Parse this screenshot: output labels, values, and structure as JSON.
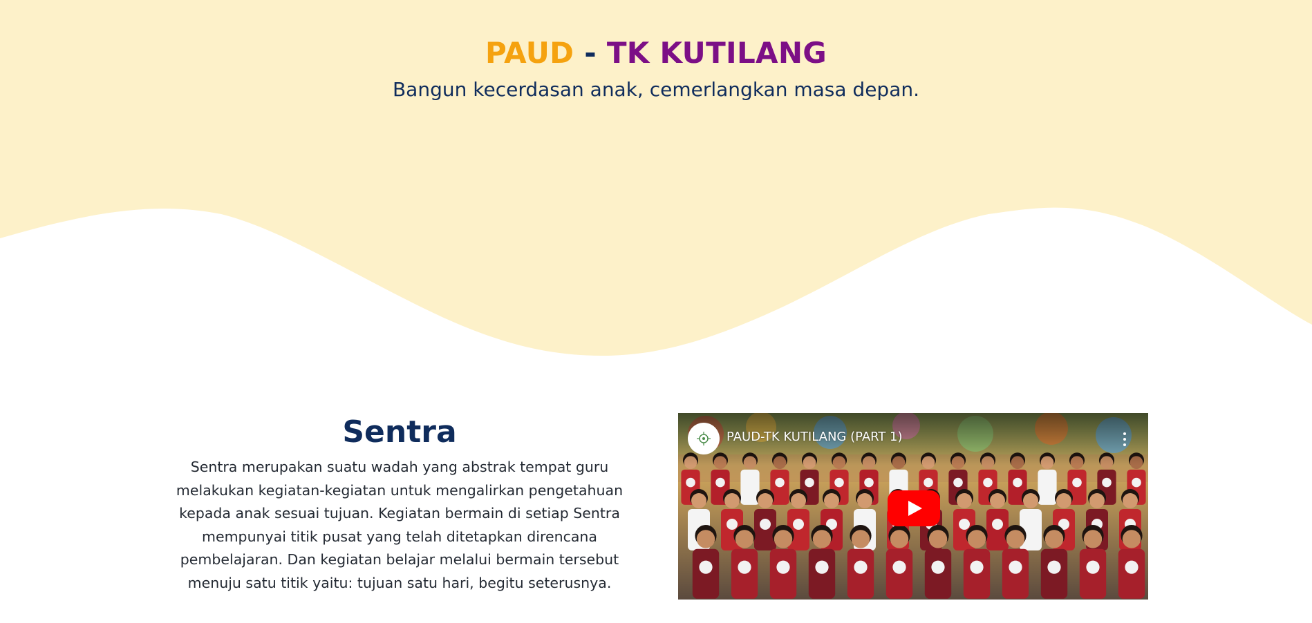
{
  "hero": {
    "title_part1": "PAUD",
    "title_sep": " - ",
    "title_part2": "TK KUTILANG",
    "subtitle": "Bangun kecerdasan anak, cemerlangkan masa depan."
  },
  "sentra": {
    "title": "Sentra",
    "body": "Sentra merupakan suatu wadah yang abstrak tempat guru melakukan kegiatan-kegiatan untuk mengalirkan pengetahuan kepada anak sesuai tujuan. Kegiatan bermain di setiap Sentra mempunyai titik pusat yang telah ditetapkan direncana pembelajaran. Dan kegiatan belajar melalui bermain tersebut menuju satu titik yaitu: tujuan satu hari, begitu seterusnya."
  },
  "video": {
    "title": "PAUD-TK KUTILANG (PART 1)",
    "play_icon": "play-icon",
    "menu_icon": "more-vert-icon",
    "avatar_icon": "channel-logo-icon"
  },
  "colors": {
    "hero_background": "#fdf1c9",
    "accent_orange": "#f5a20f",
    "accent_purple": "#7c0f86",
    "heading_navy": "#0f2c5c",
    "play_red": "#ff0000"
  }
}
